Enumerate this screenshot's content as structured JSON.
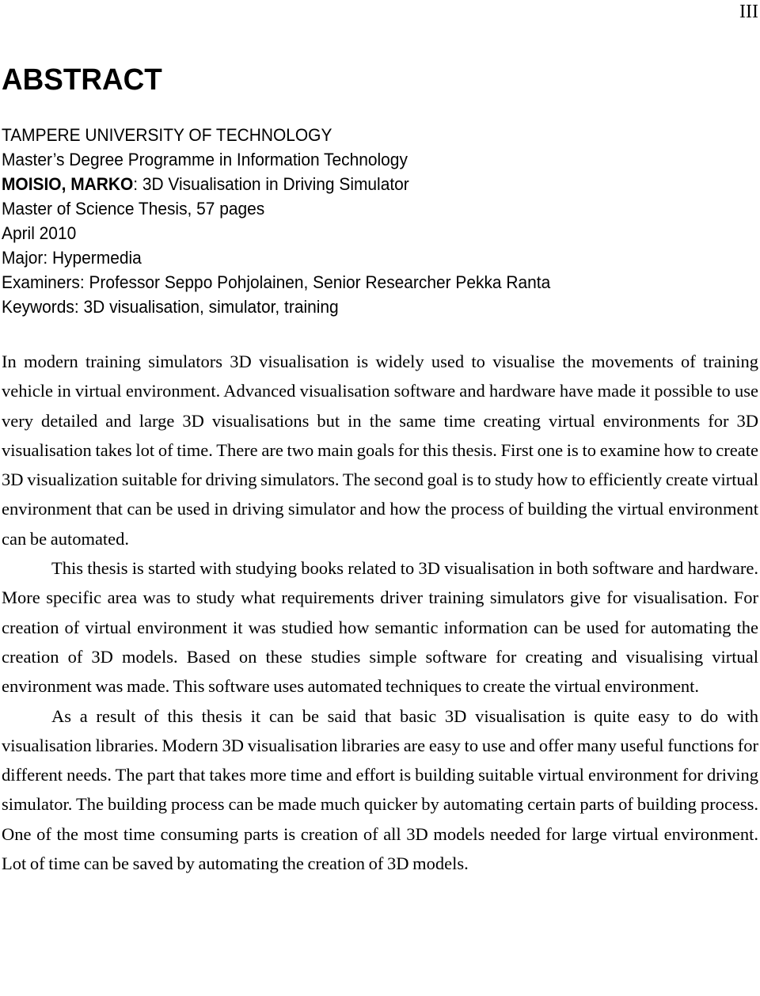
{
  "page": {
    "page_number": "III"
  },
  "abstract": {
    "title": "ABSTRACT",
    "university": "TAMPERE UNIVERSITY OF TECHNOLOGY",
    "programme": "Master’s Degree Programme in Information Technology",
    "author": "MOISIO, MARKO",
    "thesis_title": ": 3D Visualisation in Driving Simulator",
    "thesis_type": "Master of Science Thesis, 57 pages",
    "date": "April 2010",
    "major": "Major: Hypermedia",
    "examiners": "Examiners: Professor Seppo Pohjolainen, Senior Researcher Pekka Ranta",
    "keywords": "Keywords: 3D visualisation, simulator, training",
    "paragraphs": [
      "In modern training simulators 3D visualisation is widely used to visualise the movements of training vehicle in virtual environment. Advanced visualisation software and hardware have made it possible to use very detailed and large 3D visualisations but in the same time creating virtual environments for 3D visualisation takes lot of time. There are two main goals for this thesis. First one is to examine how to create 3D visualization suitable for driving simulators. The second goal is to study how to efficiently create virtual environment that can be used in driving simulator and how the process of building the virtual environment can be automated.",
      "This thesis is started with studying books related to 3D visualisation in both software and hardware. More specific area was to study what requirements driver training simulators give for visualisation. For creation of virtual environment it was studied how semantic information can be used for automating the creation of 3D models. Based on these studies simple software for creating and visualising virtual environment was made. This software uses automated techniques to create the virtual environment.",
      "As a result of this thesis it can be said that basic 3D visualisation is quite easy to do with visualisation libraries. Modern 3D visualisation libraries are easy to use and offer many useful functions for different needs. The part that takes more time and effort is building suitable virtual environment for driving simulator. The building process can be made much quicker by automating certain parts of building process. One of the most time consuming parts is creation of all 3D models needed for large virtual environment. Lot of time can be saved by automating the creation of 3D models."
    ]
  }
}
